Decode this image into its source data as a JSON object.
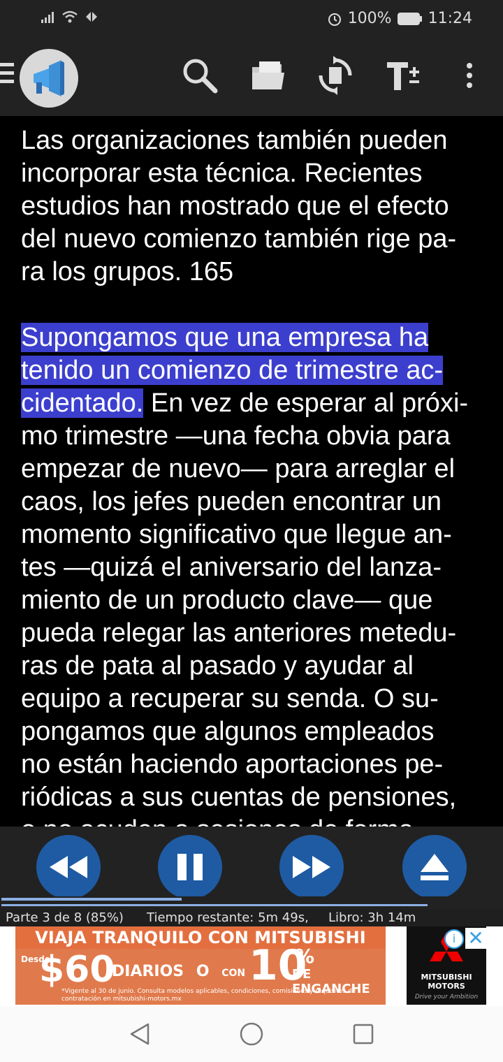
{
  "status_bar": {
    "battery": "100%",
    "time": "11:24"
  },
  "reader": {
    "paragraph1_lines": [
      "Las organizaciones también pueden",
      "incorporar esta técnica. Recientes",
      "estudios han mostrado que el efecto",
      "del nuevo comienzo también rige pa-",
      "ra los grupos. 165"
    ],
    "highlight_line1": "Supongamos que una empresa ha",
    "highlight_line2": "tenido un comienzo de trimestre ac-",
    "highlight_line3": "cidentado.",
    "line3_rest": " En vez de esperar al próxi-",
    "paragraph2_lines": [
      "mo trimestre —una fecha obvia para",
      "empezar de nuevo— para arreglar el",
      "caos, los jefes pueden encontrar un",
      "momento significativo que llegue an-",
      "tes —quizá el aniversario del lanza-",
      "miento de un producto clave— que",
      "pueda relegar las anteriores metedu-",
      "ras de pata al pasado y ayudar al",
      "equipo a recuperar su senda. O su-",
      "pongamos que algunos empleados",
      "no están haciendo aportaciones pe-",
      "riódicas a sus cuentas de pensiones,",
      "o no acuden a sesiones de forma-"
    ]
  },
  "playback": {
    "progress_fraction": 0.36,
    "part": "Parte 3 de 8 (85%)",
    "remaining": "Tiempo restante: 5m 49s,",
    "book": "Libro: 3h 14m"
  },
  "ad": {
    "headline": "VIAJA TRANQUILO CON MITSUBISHI",
    "desde": "Desde",
    "amount": "$60",
    "diarios": "DIARIOS",
    "o": "O",
    "con": "CON",
    "percent_value": "10",
    "percent_sign": "%",
    "enganche": "DE ENGANCHE",
    "fine_print": "*Vigente al 30 de junio. Consulta modelos aplicables, condiciones, comisiones y requisitos de contratación en mitsubishi-motors.mx",
    "brand_name": "MITSUBISHI MOTORS",
    "brand_tagline": "Drive your Ambition"
  },
  "icons": [
    "signal-icon",
    "wifi-icon",
    "data-icon",
    "alarm-icon",
    "battery-icon",
    "menu-icon",
    "megaphone-logo-icon",
    "search-icon",
    "folder-icon",
    "sync-icon",
    "text-size-icon",
    "more-vert-icon",
    "rewind-icon",
    "pause-icon",
    "fast-forward-icon",
    "eject-icon",
    "info-icon",
    "close-icon",
    "back-icon",
    "home-icon",
    "recents-icon"
  ],
  "colors": {
    "highlight": "#3c3fcd",
    "control_button": "#1e5ba3",
    "progress": "#8cb0e6"
  }
}
